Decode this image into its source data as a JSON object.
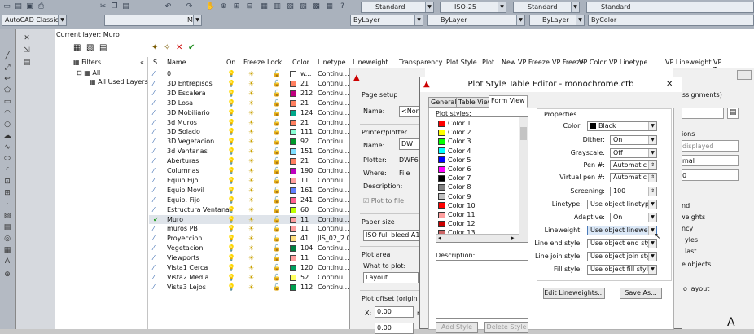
{
  "toolbar": {
    "workspace": "AutoCAD Classic",
    "layer_combo": "Muro",
    "textstyle": "Standard",
    "dimstyle": "ISO-25",
    "tablestyle": "Standard",
    "mleaderstyle": "Standard",
    "linetype_bylayer": "ByLayer",
    "lineweight_bylayer": "ByLayer",
    "linetype_bylayer2": "ByLayer",
    "color": "ByColor"
  },
  "layer_manager": {
    "current_layer": "Current layer: Muro",
    "filters_title": "Filters",
    "tree_all": "All",
    "tree_used": "All Used Layers",
    "columns": [
      "S..",
      "Name",
      "On",
      "Freeze",
      "Lock",
      "Color",
      "Linetype",
      "Lineweight",
      "Transparency",
      "Plot Style",
      "Plot",
      "New VP Freeze",
      "VP Freeze",
      "VP Color",
      "VP Linetype",
      "VP Lineweight",
      "VP Transparen"
    ],
    "layers": [
      {
        "name": "0",
        "color_num": "w...",
        "linetype": "Continu...",
        "color_hex": "#ffffff"
      },
      {
        "name": "3D Entrepisos",
        "color_num": "21",
        "linetype": "Continu...",
        "color_hex": "#ff7f5f"
      },
      {
        "name": "3D Escalera",
        "color_num": "212",
        "linetype": "Continu...",
        "color_hex": "#c0007f"
      },
      {
        "name": "3D Losa",
        "color_num": "21",
        "linetype": "Continu...",
        "color_hex": "#ff7f5f"
      },
      {
        "name": "3D Mobiliario",
        "color_num": "124",
        "linetype": "Continu...",
        "color_hex": "#00a88a"
      },
      {
        "name": "3d Muros",
        "color_num": "21",
        "linetype": "Continu...",
        "color_hex": "#ff7f5f"
      },
      {
        "name": "3D Solado",
        "color_num": "111",
        "linetype": "Continu...",
        "color_hex": "#8affd4"
      },
      {
        "name": "3D Vegetacion",
        "color_num": "92",
        "linetype": "Continu...",
        "color_hex": "#009a2a"
      },
      {
        "name": "3d Ventanas",
        "color_num": "151",
        "linetype": "Continu...",
        "color_hex": "#7fdfff"
      },
      {
        "name": "Aberturas",
        "color_num": "21",
        "linetype": "Continu...",
        "color_hex": "#ff7f5f"
      },
      {
        "name": "Columnas",
        "color_num": "190",
        "linetype": "Continu...",
        "color_hex": "#c000c0"
      },
      {
        "name": "Equip Fijo",
        "color_num": "11",
        "linetype": "Continu...",
        "color_hex": "#ff9f9f"
      },
      {
        "name": "Equip Movil",
        "color_num": "161",
        "linetype": "Continu...",
        "color_hex": "#5f7fff"
      },
      {
        "name": "Equip. Fijo",
        "color_num": "241",
        "linetype": "Continu...",
        "color_hex": "#ff5f8f"
      },
      {
        "name": "Estructura Ventana",
        "color_num": "60",
        "linetype": "Continu...",
        "color_hex": "#bfff00"
      },
      {
        "name": "Muro",
        "color_num": "11",
        "linetype": "Continu...",
        "color_hex": "#ff9f9f",
        "current": true
      },
      {
        "name": "muros PB",
        "color_num": "11",
        "linetype": "Continu...",
        "color_hex": "#ff9f9f"
      },
      {
        "name": "Proyeccion",
        "color_num": "41",
        "linetype": "JIS_02_2.0",
        "color_hex": "#ffdf7f"
      },
      {
        "name": "Vegetacion",
        "color_num": "104",
        "linetype": "Continu...",
        "color_hex": "#007f3f"
      },
      {
        "name": "Viewports",
        "color_num": "11",
        "linetype": "Continu...",
        "color_hex": "#ff9f9f"
      },
      {
        "name": "Vista1 Cerca",
        "color_num": "120",
        "linetype": "Continu...",
        "color_hex": "#009f5f"
      },
      {
        "name": "Vista2 Media",
        "color_num": "52",
        "linetype": "Continu...",
        "color_hex": "#ffff5f"
      },
      {
        "name": "Vista3 Lejos",
        "color_num": "112",
        "linetype": "Continu...",
        "color_hex": "#009f4f"
      }
    ]
  },
  "page_setup": {
    "section_page_setup": "Page setup",
    "name_label": "Name:",
    "name_value": "<None",
    "section_printer": "Printer/plotter",
    "printer_name_label": "Name:",
    "printer_name_value": "DW",
    "plotter_label": "Plotter:",
    "plotter_value": "DWF6 el",
    "where_label": "Where:",
    "where_value": "File",
    "description_label": "Description:",
    "plot_to_file": "Plot to file",
    "section_paper": "Paper size",
    "paper_value": "ISO full bleed A1 (84",
    "section_plot_area": "Plot area",
    "what_to_plot": "What to plot:",
    "what_value": "Layout",
    "section_offset": "Plot offset (origin set t",
    "x_label": "X:",
    "x_value": "0.00",
    "y_value": "0.00",
    "unit": "m"
  },
  "right_panel": {
    "assignments": "assignments)",
    "ions": "ions",
    "displayed": "displayed",
    "mal": "mal",
    "zero": "0",
    "nd": "nd",
    "weights": "weights",
    "ncy": "ncy",
    "yles": "yles",
    "last": "last",
    "e_objects": "e objects",
    "o_layout": "o layout",
    "big_a": "A"
  },
  "editor": {
    "title": "Plot Style Table Editor - monochrome.ctb",
    "tabs": [
      "General",
      "Table View",
      "Form View"
    ],
    "active_tab": "Form View",
    "plot_styles_label": "Plot styles:",
    "styles": [
      {
        "name": "Color 1",
        "hex": "#ff0000"
      },
      {
        "name": "Color 2",
        "hex": "#ffff00"
      },
      {
        "name": "Color 3",
        "hex": "#00ff00"
      },
      {
        "name": "Color 4",
        "hex": "#00ffff"
      },
      {
        "name": "Color 5",
        "hex": "#0000ff"
      },
      {
        "name": "Color 6",
        "hex": "#ff00ff"
      },
      {
        "name": "Color 7",
        "hex": "#000000"
      },
      {
        "name": "Color 8",
        "hex": "#808080"
      },
      {
        "name": "Color 9",
        "hex": "#c0c0c0"
      },
      {
        "name": "Color 10",
        "hex": "#ff0000"
      },
      {
        "name": "Color 11",
        "hex": "#ff9f9f"
      },
      {
        "name": "Color 12",
        "hex": "#cc0000"
      },
      {
        "name": "Color 13",
        "hex": "#cc6666"
      }
    ],
    "description_label": "Description:",
    "add_style": "Add Style",
    "delete_style": "Delete Style",
    "properties_title": "Properties",
    "props": [
      {
        "label": "Color:",
        "value": "Black"
      },
      {
        "label": "Dither:",
        "value": "On"
      },
      {
        "label": "Grayscale:",
        "value": "Off"
      },
      {
        "label": "Pen #:",
        "value": "Automatic"
      },
      {
        "label": "Virtual pen #:",
        "value": "Automatic"
      },
      {
        "label": "Screening:",
        "value": "100"
      },
      {
        "label": "Linetype:",
        "value": "Use object linetype"
      },
      {
        "label": "Adaptive:",
        "value": "On"
      },
      {
        "label": "Lineweight:",
        "value": "Use object lineweight"
      },
      {
        "label": "Line end style:",
        "value": "Use object end style"
      },
      {
        "label": "Line join style:",
        "value": "Use object join style"
      },
      {
        "label": "Fill style:",
        "value": "Use object fill style"
      }
    ],
    "edit_lineweights": "Edit Lineweights...",
    "save_as": "Save As..."
  }
}
